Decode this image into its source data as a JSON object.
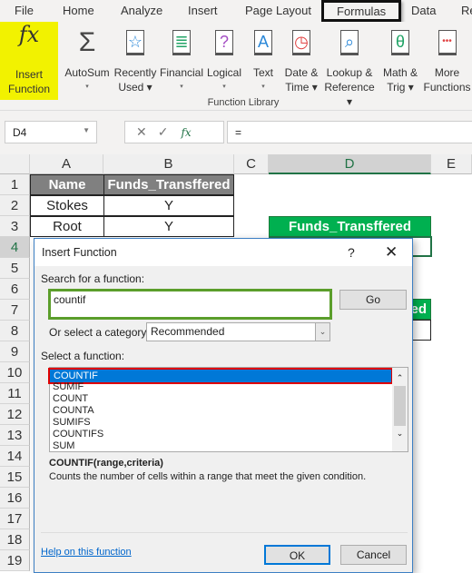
{
  "ribbon_tabs": [
    "File",
    "Home",
    "Analyze",
    "Insert",
    "Page Layout",
    "Formulas",
    "Data",
    "Re"
  ],
  "ribbon": {
    "insert_function": [
      "Insert",
      "Function"
    ],
    "buttons": [
      {
        "icon": "sum-icon",
        "l1": "AutoSum",
        "l2": "▾"
      },
      {
        "icon": "star-book-icon",
        "l1": "Recently",
        "l2": "Used ▾"
      },
      {
        "icon": "database-book-icon",
        "l1": "Financial",
        "l2": "▾"
      },
      {
        "icon": "question-book-icon",
        "l1": "Logical",
        "l2": "▾"
      },
      {
        "icon": "text-book-icon",
        "l1": "Text",
        "l2": "▾"
      },
      {
        "icon": "clock-book-icon",
        "l1": "Date &",
        "l2": "Time ▾"
      },
      {
        "icon": "magnifier-book-icon",
        "l1": "Lookup &",
        "l2": "Reference ▾"
      },
      {
        "icon": "theta-book-icon",
        "l1": "Math &",
        "l2": "Trig ▾"
      },
      {
        "icon": "more-book-icon",
        "l1": "More",
        "l2": "Functions"
      }
    ],
    "group_label": "Function Library"
  },
  "formula_bar": {
    "name_box": "D4",
    "formula": "="
  },
  "columns": [
    "A",
    "B",
    "C",
    "D",
    "E"
  ],
  "rows": [
    "1",
    "2",
    "3",
    "4",
    "5",
    "6",
    "7",
    "8",
    "9",
    "10",
    "11",
    "12",
    "13",
    "14",
    "15",
    "16",
    "17",
    "18",
    "19"
  ],
  "cells": {
    "a1": "Name",
    "b1": "Funds_Transffered",
    "a2": "Stokes",
    "b2": "Y",
    "a3": "Root",
    "b3": "Y",
    "d3": "Funds_Transffered",
    "d7": "ed"
  },
  "dialog": {
    "title": "Insert Function",
    "help": "?",
    "search_label": "Search for a function:",
    "search_value": "countif",
    "go": "Go",
    "category_label": "Or select a category:",
    "category_value": "Recommended",
    "select_label": "Select a function:",
    "functions": [
      "COUNTIF",
      "SUMIF",
      "COUNT",
      "COUNTA",
      "SUMIFS",
      "COUNTIFS",
      "SUM"
    ],
    "selected": "COUNTIF",
    "syntax": "COUNTIF(range,criteria)",
    "description": "Counts the number of cells within a range that meet the given condition.",
    "help_link": "Help on this function",
    "ok": "OK",
    "cancel": "Cancel"
  },
  "colors": {
    "highlight": "#f2f200",
    "green": "#00b050",
    "selection": "#0078d7",
    "red_outline": "#e00000"
  }
}
